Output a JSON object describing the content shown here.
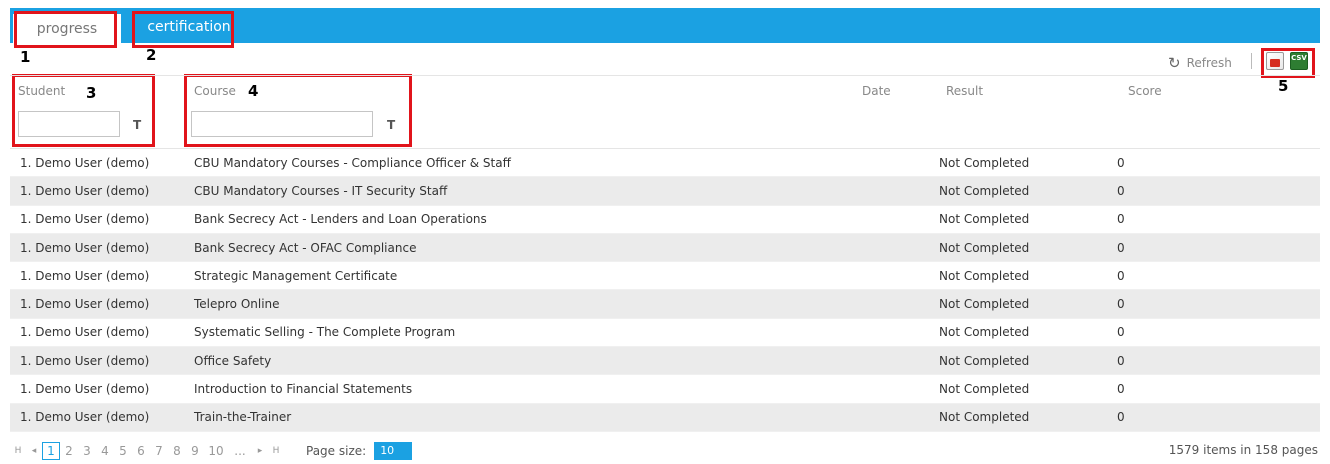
{
  "tabs": [
    {
      "label": "progress"
    },
    {
      "label": "certification"
    }
  ],
  "annotations": [
    "1",
    "2",
    "3",
    "4",
    "5"
  ],
  "toolbar": {
    "refresh_label": "Refresh",
    "refresh_icon": "refresh-icon",
    "export_pdf_icon": "pdf-export-icon",
    "export_csv_icon": "csv-export-icon",
    "csv_text": "CSV"
  },
  "columns": {
    "student": "Student",
    "course": "Course",
    "date": "Date",
    "result": "Result",
    "score": "Score"
  },
  "filters": {
    "student_value": "",
    "course_value": "",
    "icon": "T"
  },
  "rows": [
    {
      "student": "1. Demo User (demo)",
      "course": "CBU Mandatory Courses - Compliance Officer & Staff",
      "date": "",
      "result": "Not Completed",
      "score": "0"
    },
    {
      "student": "1. Demo User (demo)",
      "course": "CBU Mandatory Courses - IT Security Staff",
      "date": "",
      "result": "Not Completed",
      "score": "0"
    },
    {
      "student": "1. Demo User (demo)",
      "course": "Bank Secrecy Act - Lenders and Loan Operations",
      "date": "",
      "result": "Not Completed",
      "score": "0"
    },
    {
      "student": "1. Demo User (demo)",
      "course": "Bank Secrecy Act - OFAC Compliance",
      "date": "",
      "result": "Not Completed",
      "score": "0"
    },
    {
      "student": "1. Demo User (demo)",
      "course": "Strategic Management Certificate",
      "date": "",
      "result": "Not Completed",
      "score": "0"
    },
    {
      "student": "1. Demo User (demo)",
      "course": "Telepro Online",
      "date": "",
      "result": "Not Completed",
      "score": "0"
    },
    {
      "student": "1. Demo User (demo)",
      "course": "Systematic Selling - The Complete Program",
      "date": "",
      "result": "Not Completed",
      "score": "0"
    },
    {
      "student": "1. Demo User (demo)",
      "course": "Office Safety",
      "date": "",
      "result": "Not Completed",
      "score": "0"
    },
    {
      "student": "1. Demo User (demo)",
      "course": "Introduction to Financial Statements",
      "date": "",
      "result": "Not Completed",
      "score": "0"
    },
    {
      "student": "1. Demo User (demo)",
      "course": "Train-the-Trainer",
      "date": "",
      "result": "Not Completed",
      "score": "0"
    }
  ],
  "pager": {
    "first": "H",
    "prev": "◂",
    "next": "▸",
    "last": "H",
    "pages": [
      "1",
      "2",
      "3",
      "4",
      "5",
      "6",
      "7",
      "8",
      "9",
      "10",
      "..."
    ],
    "current_page": "1",
    "page_size_label": "Page size:",
    "page_size": "10",
    "summary": "1579 items in 158 pages"
  },
  "colors": {
    "accent": "#1ba1e2",
    "annotation": "#e1141b",
    "row_alt": "#ebebeb"
  }
}
